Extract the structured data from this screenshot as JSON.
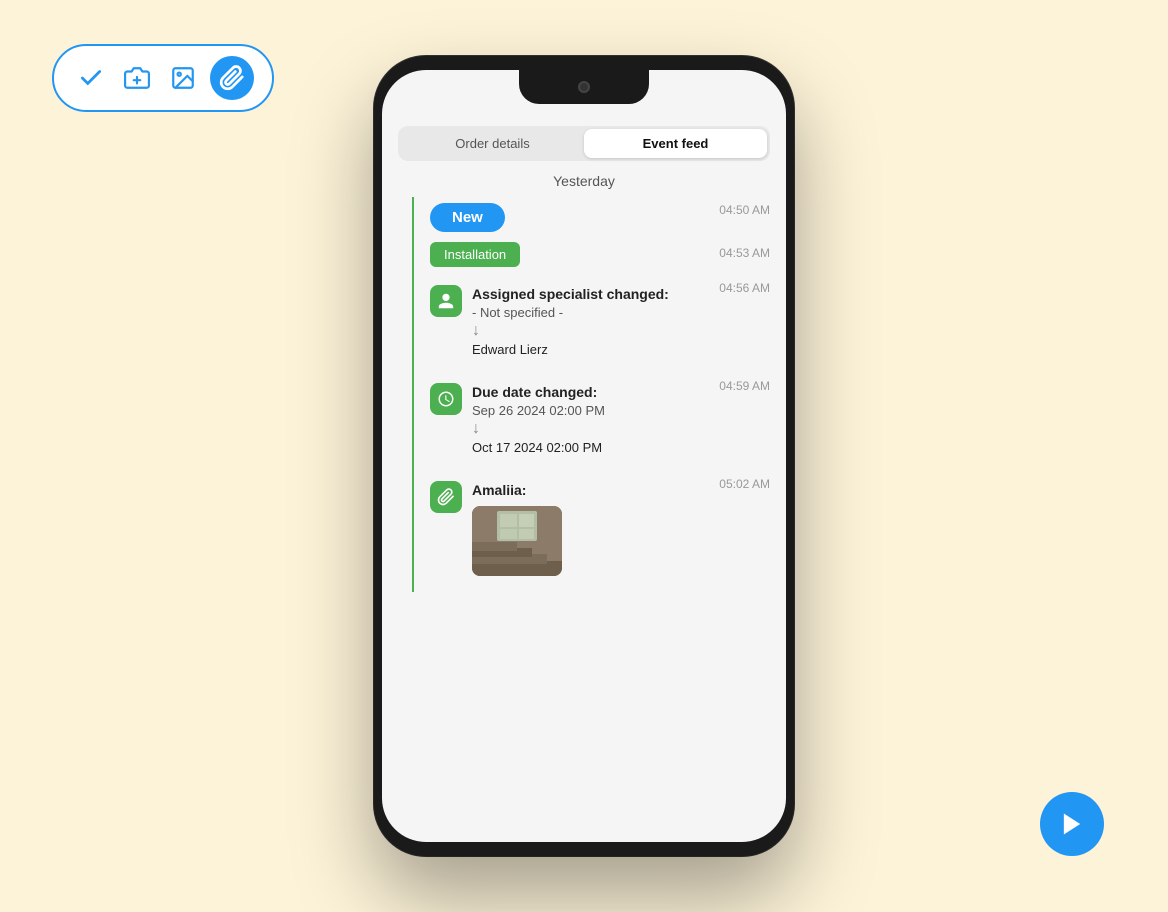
{
  "background_color": "#fdf3d8",
  "toolbar": {
    "check_label": "check",
    "camera_label": "camera-add",
    "image_label": "image",
    "clip_label": "paperclip"
  },
  "phone": {
    "tabs": [
      {
        "label": "Order details",
        "active": false
      },
      {
        "label": "Event feed",
        "active": true
      }
    ],
    "feed": {
      "date_header": "Yesterday",
      "entries": [
        {
          "type": "badge",
          "badge_text": "New",
          "time": "04:50 AM"
        },
        {
          "type": "category",
          "category_text": "Installation",
          "time": "04:53 AM"
        },
        {
          "type": "event",
          "icon": "person",
          "title": "Assigned specialist changed:",
          "from": "- Not specified -",
          "to": "Edward  Lierz",
          "time": "04:56 AM"
        },
        {
          "type": "event",
          "icon": "clock",
          "title": "Due date changed:",
          "from": "Sep 26 2024 02:00 PM",
          "to": "Oct 17 2024 02:00 PM",
          "time": "04:59 AM"
        },
        {
          "type": "event",
          "icon": "clip",
          "title": "Amaliia:",
          "has_image": true,
          "time": "05:02 AM"
        }
      ]
    }
  },
  "play_button": {
    "label": "play"
  }
}
